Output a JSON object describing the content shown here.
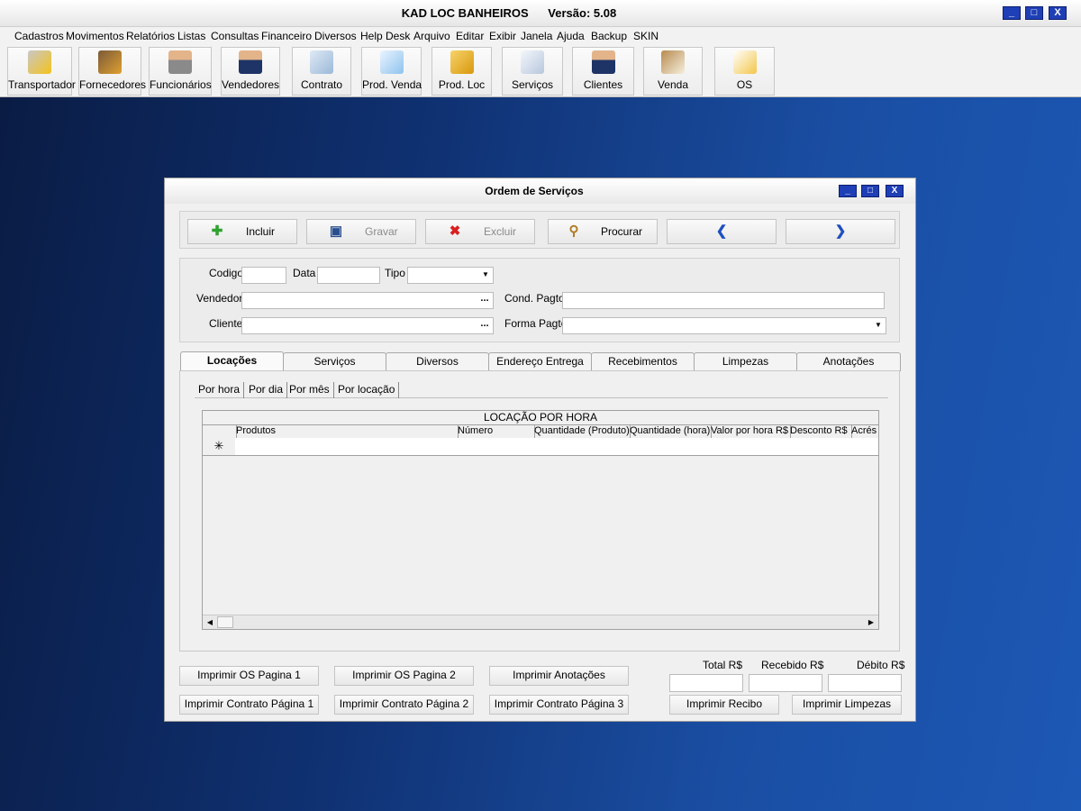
{
  "app": {
    "title": "KAD LOC BANHEIROS      Versão: 5.08",
    "window_controls": [
      "_",
      "□",
      "X"
    ]
  },
  "menu": [
    "Cadastros",
    "Movimentos",
    "Relatórios",
    "Listas",
    "Consultas",
    "Financeiro",
    "Diversos",
    "Help Desk",
    "Arquivo",
    "Editar",
    "Exibir",
    "Janela",
    "Ajuda",
    "Backup",
    "SKIN"
  ],
  "toolbar": [
    {
      "label": "Transportador",
      "icon": "truck-icon"
    },
    {
      "label": "Fornecedores",
      "icon": "suppliers-icon"
    },
    {
      "label": "Funcionários",
      "icon": "employee-icon"
    },
    {
      "label": "Vendedores",
      "icon": "salesperson-icon"
    },
    {
      "label": "Contrato",
      "icon": "contract-icon"
    },
    {
      "label": "Prod. Venda",
      "icon": "box-open-icon"
    },
    {
      "label": "Prod. Loc",
      "icon": "box-icon"
    },
    {
      "label": "Serviços",
      "icon": "document-icon"
    },
    {
      "label": "Clientes",
      "icon": "client-icon"
    },
    {
      "label": "Venda",
      "icon": "clipboard-icon"
    },
    {
      "label": "OS",
      "icon": "pencil-note-icon"
    }
  ],
  "dialog": {
    "title": "Ordem de Serviços",
    "actions": {
      "incluir": "Incluir",
      "gravar": "Gravar",
      "excluir": "Excluir",
      "procurar": "Procurar",
      "prev": "❮",
      "next": "❯"
    },
    "form": {
      "codigo_label": "Codigo",
      "codigo_value": "",
      "data_label": "Data",
      "data_value": "",
      "tipo_label": "Tipo",
      "tipo_value": "",
      "vendedor_label": "Vendedor",
      "vendedor_value": "",
      "cliente_label": "Cliente",
      "cliente_value": "",
      "cond_pagto_label": "Cond. Pagto",
      "cond_pagto_value": "",
      "forma_pagto_label": "Forma Pagto",
      "forma_pagto_value": "",
      "ellipsis": "..."
    },
    "tabs": [
      "Locações",
      "Serviços",
      "Diversos",
      "Endereço Entrega",
      "Recebimentos",
      "Limpezas",
      "Anotações"
    ],
    "active_tab": "Locações",
    "subtabs": [
      "Por hora",
      "Por dia",
      "Por mês",
      "Por locação"
    ],
    "active_subtab": "Por hora",
    "grid": {
      "caption": "LOCAÇÃO POR HORA",
      "columns": [
        "Produtos",
        "Número",
        "Quantidade (Produto)",
        "Quantidade (hora)",
        "Valor por hora R$",
        "Desconto R$",
        "Acrés"
      ],
      "new_row_marker": "✳"
    },
    "print_buttons": {
      "os_p1": "Imprimir OS Pagina 1",
      "os_p2": "Imprimir OS Pagina 2",
      "anotacoes": "Imprimir Anotações",
      "contrato_p1": "Imprimir Contrato Página 1",
      "contrato_p2": "Imprimir Contrato Página 2",
      "contrato_p3": "Imprimir Contrato Página 3",
      "recibo": "Imprimir Recibo",
      "limpezas": "Imprimir Limpezas"
    },
    "totals": {
      "total_label": "Total R$",
      "total_value": "",
      "recebido_label": "Recebido R$",
      "recebido_value": "",
      "debito_label": "Débito R$",
      "debito_value": ""
    }
  },
  "colors": {
    "accent": "#1f3fb6",
    "desktop": "#1a4ea3",
    "incluir_icon": "#2fa32f",
    "excluir_icon": "#d82020"
  }
}
